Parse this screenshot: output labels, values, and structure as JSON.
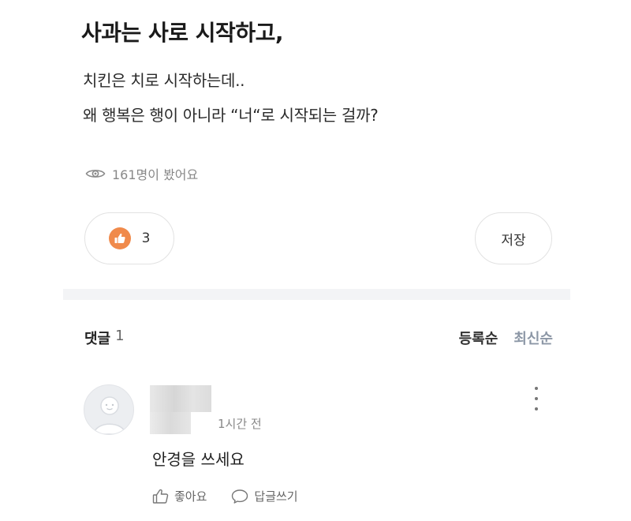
{
  "post": {
    "title": "사과는 사로 시작하고,",
    "body_lines": [
      "치킨은 치로 시작하는데..",
      "왜 행복은 행이 아니라 “너“로 시작되는 걸까?"
    ],
    "views": "161명이 봤어요"
  },
  "actions": {
    "like_count": "3",
    "save_label": "저장"
  },
  "comments": {
    "label": "댓글",
    "count": "1",
    "sort_registered": "등록순",
    "sort_latest": "최신순",
    "items": [
      {
        "time": "1시간 전",
        "text": "안경을 쓰세요",
        "like_label": "좋아요",
        "reply_label": "답글쓰기"
      }
    ]
  },
  "colors": {
    "like_accent": "#f08a4b",
    "sort_inactive": "#8c97a6"
  },
  "icons": [
    "eye-icon",
    "thumbs-up-icon",
    "more-vertical-icon",
    "avatar-placeholder-icon",
    "speech-bubble-icon"
  ]
}
